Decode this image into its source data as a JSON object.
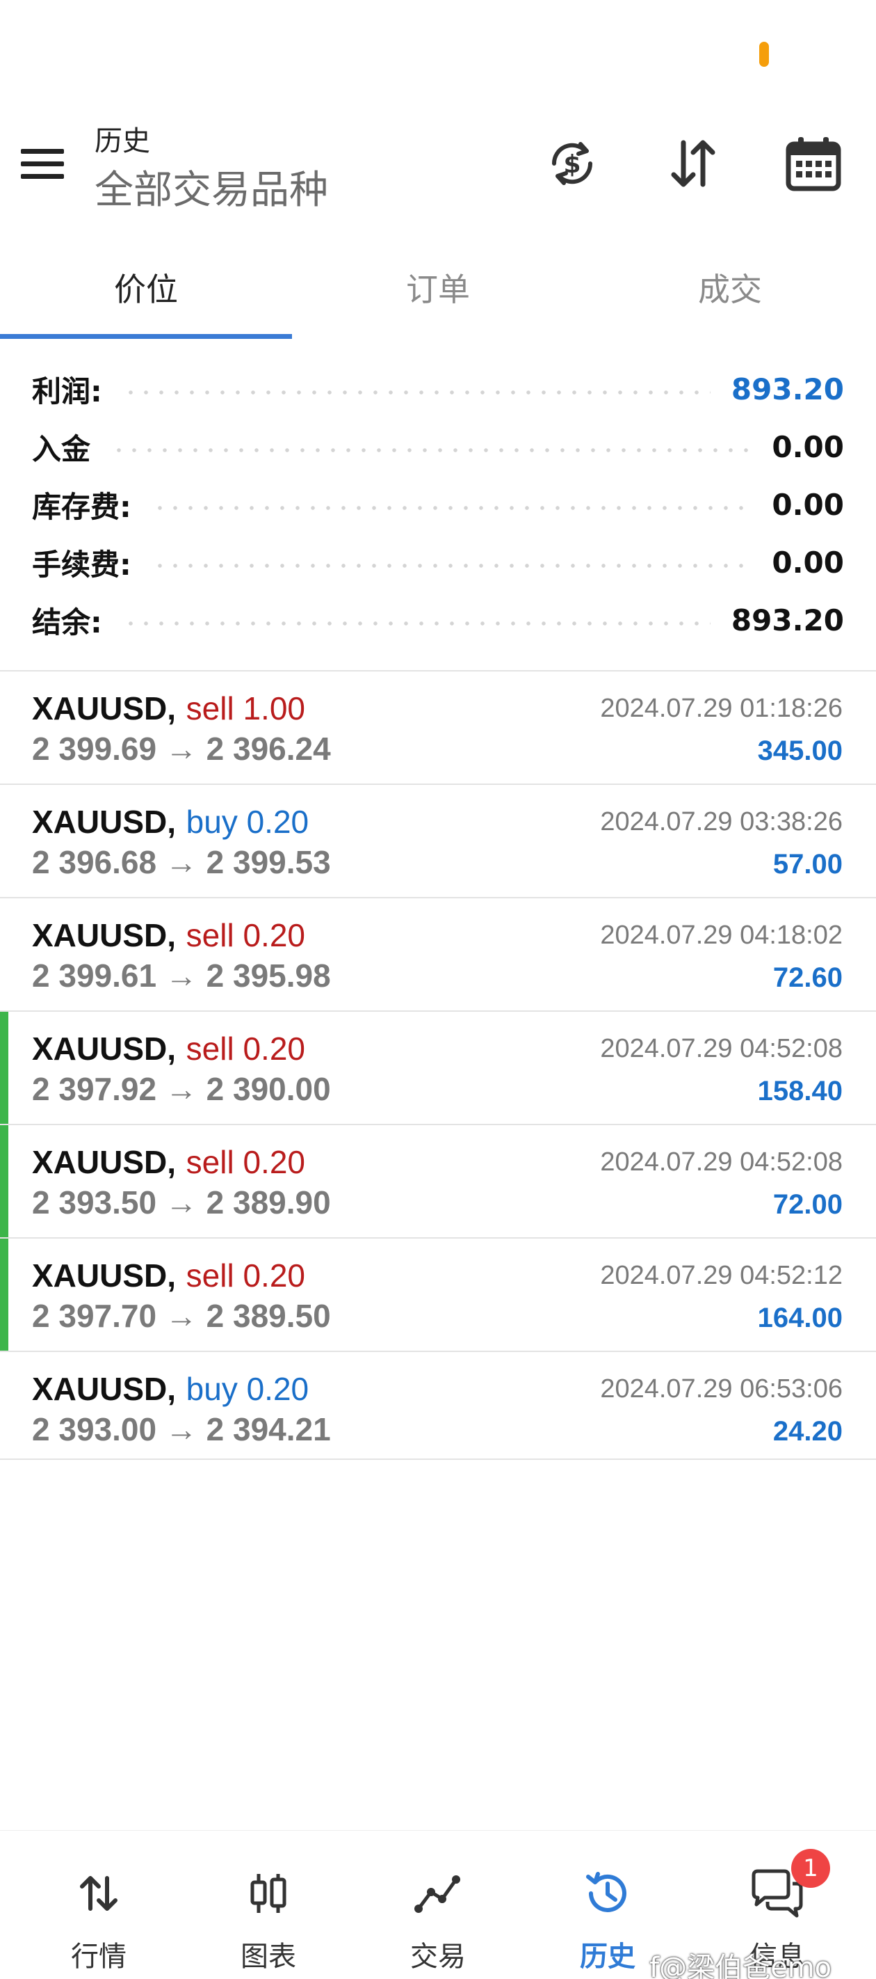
{
  "header": {
    "title": "历史",
    "subtitle": "全部交易品种"
  },
  "tabs": [
    {
      "label": "价位",
      "active": true
    },
    {
      "label": "订单",
      "active": false
    },
    {
      "label": "成交",
      "active": false
    }
  ],
  "summary": {
    "rows": [
      {
        "label": "利润:",
        "value": "893.20",
        "highlight": true
      },
      {
        "label": "入金",
        "value": "0.00",
        "highlight": false
      },
      {
        "label": "库存费:",
        "value": "0.00",
        "highlight": false
      },
      {
        "label": "手续费:",
        "value": "0.00",
        "highlight": false
      },
      {
        "label": "结余:",
        "value": "893.20",
        "highlight": false
      }
    ]
  },
  "deals": [
    {
      "symbol": "XAUUSD,",
      "side": "sell 1.00",
      "type": "sell",
      "prices": "2 399.69 → 2 396.24",
      "time": "2024.07.29 01:18:26",
      "profit": "345.00",
      "accent": false
    },
    {
      "symbol": "XAUUSD,",
      "side": "buy 0.20",
      "type": "buy",
      "prices": "2 396.68 → 2 399.53",
      "time": "2024.07.29 03:38:26",
      "profit": "57.00",
      "accent": false
    },
    {
      "symbol": "XAUUSD,",
      "side": "sell 0.20",
      "type": "sell",
      "prices": "2 399.61 → 2 395.98",
      "time": "2024.07.29 04:18:02",
      "profit": "72.60",
      "accent": false
    },
    {
      "symbol": "XAUUSD,",
      "side": "sell 0.20",
      "type": "sell",
      "prices": "2 397.92 → 2 390.00",
      "time": "2024.07.29 04:52:08",
      "profit": "158.40",
      "accent": true
    },
    {
      "symbol": "XAUUSD,",
      "side": "sell 0.20",
      "type": "sell",
      "prices": "2 393.50 → 2 389.90",
      "time": "2024.07.29 04:52:08",
      "profit": "72.00",
      "accent": true
    },
    {
      "symbol": "XAUUSD,",
      "side": "sell 0.20",
      "type": "sell",
      "prices": "2 397.70 → 2 389.50",
      "time": "2024.07.29 04:52:12",
      "profit": "164.00",
      "accent": true
    },
    {
      "symbol": "XAUUSD,",
      "side": "buy 0.20",
      "type": "buy",
      "prices": "2 393.00 → 2 394.21",
      "time": "2024.07.29 06:53:06",
      "profit": "24.20",
      "accent": false
    }
  ],
  "nav": {
    "items": [
      {
        "label": "行情",
        "icon": "arrows-up-down-icon",
        "active": false
      },
      {
        "label": "图表",
        "icon": "candlestick-icon",
        "active": false
      },
      {
        "label": "交易",
        "icon": "trade-line-icon",
        "active": false
      },
      {
        "label": "历史",
        "icon": "history-clock-icon",
        "active": true
      },
      {
        "label": "信息",
        "icon": "chat-bubbles-icon",
        "active": false,
        "badge": "1"
      }
    ]
  },
  "watermark": "f@梁伯爸emo",
  "colors": {
    "accent_blue": "#3a7bd5",
    "profit_blue": "#1a6fc9",
    "sell_red": "#b91c1c",
    "buy_blue": "#1a6fc9",
    "accent_green": "#3cb54a",
    "badge_red": "#ef4444"
  }
}
